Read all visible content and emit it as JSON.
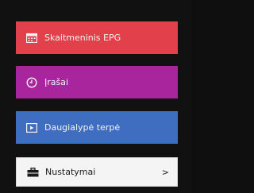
{
  "menu": {
    "items": [
      {
        "label": "Skaitmeninis EPG",
        "icon": "calendar-icon",
        "color": "#e2404a"
      },
      {
        "label": "Įrašai",
        "icon": "clock-icon",
        "color": "#a8259e"
      },
      {
        "label": "Daugialypė terpė",
        "icon": "media-icon",
        "color": "#3f6ec0"
      },
      {
        "label": "Nustatymai",
        "icon": "toolbox-icon",
        "color": "#f4f4f4",
        "arrow": ">"
      }
    ]
  }
}
